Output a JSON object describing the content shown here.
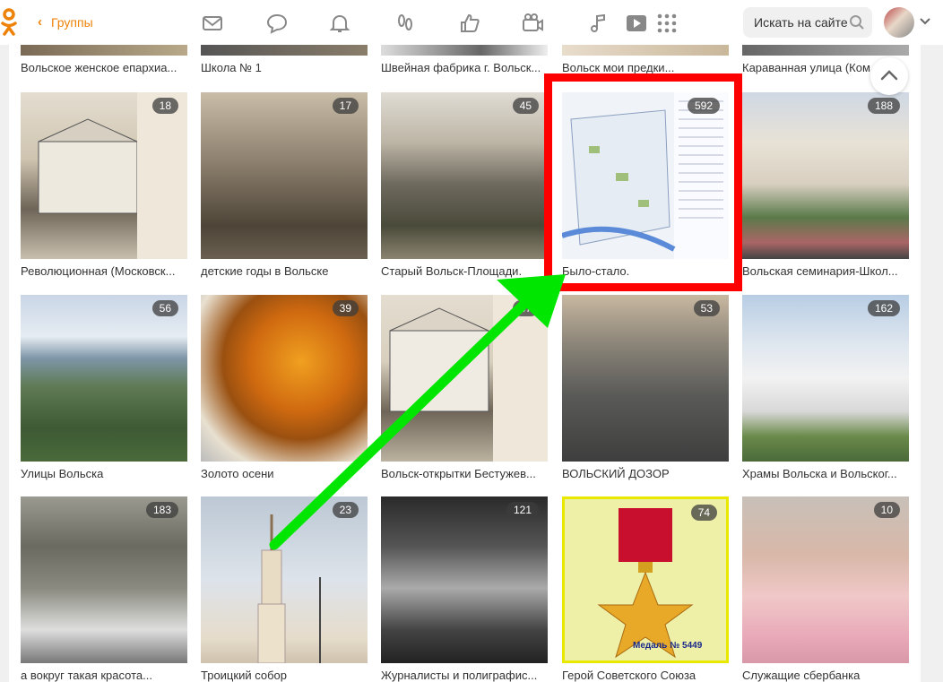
{
  "header": {
    "back_label": "Группы",
    "search_placeholder": "Искать на сайте",
    "nav_icons": [
      "mail-icon",
      "chat-icon",
      "bell-icon",
      "guests-icon",
      "like-icon",
      "camera-icon",
      "music-icon",
      "video-icon",
      "apps-icon"
    ]
  },
  "top_row": [
    {
      "caption": "Вольское женское епархиа..."
    },
    {
      "caption": "Школа № 1"
    },
    {
      "caption": "Швейная фабрика г. Вольск..."
    },
    {
      "caption": "Вольск мои предки..."
    },
    {
      "caption": "Караванная улица (Ком..."
    }
  ],
  "albums": [
    {
      "caption": "Революционная (Московск...",
      "count": "18"
    },
    {
      "caption": "детские годы в Вольске",
      "count": "17"
    },
    {
      "caption": "Старый Вольск-Площади.",
      "count": "45"
    },
    {
      "caption": "Было-стало.",
      "count": "592"
    },
    {
      "caption": "Вольская семинария-Школ...",
      "count": "188"
    },
    {
      "caption": "Улицы Вольска",
      "count": "56"
    },
    {
      "caption": "Золото осени",
      "count": "39"
    },
    {
      "caption": "Вольск-открытки Бестужев...",
      "count": "37"
    },
    {
      "caption": "ВОЛЬСКИЙ ДОЗОР",
      "count": "53"
    },
    {
      "caption": "Храмы Вольска и Вольског...",
      "count": "162"
    },
    {
      "caption": "а вокруг такая красота...",
      "count": "183"
    },
    {
      "caption": "Троицкий собор",
      "count": "23"
    },
    {
      "caption": "Журналисты и полиграфис...",
      "count": "121"
    },
    {
      "caption": "Герой Советского Союза",
      "count": "74"
    },
    {
      "caption": "Служащие сбербанка",
      "count": "10"
    }
  ],
  "medal_label": "Медаль № 5449",
  "colors": {
    "accent": "#ee8208",
    "highlight_box": "#ff0000",
    "arrow": "#00e600"
  }
}
